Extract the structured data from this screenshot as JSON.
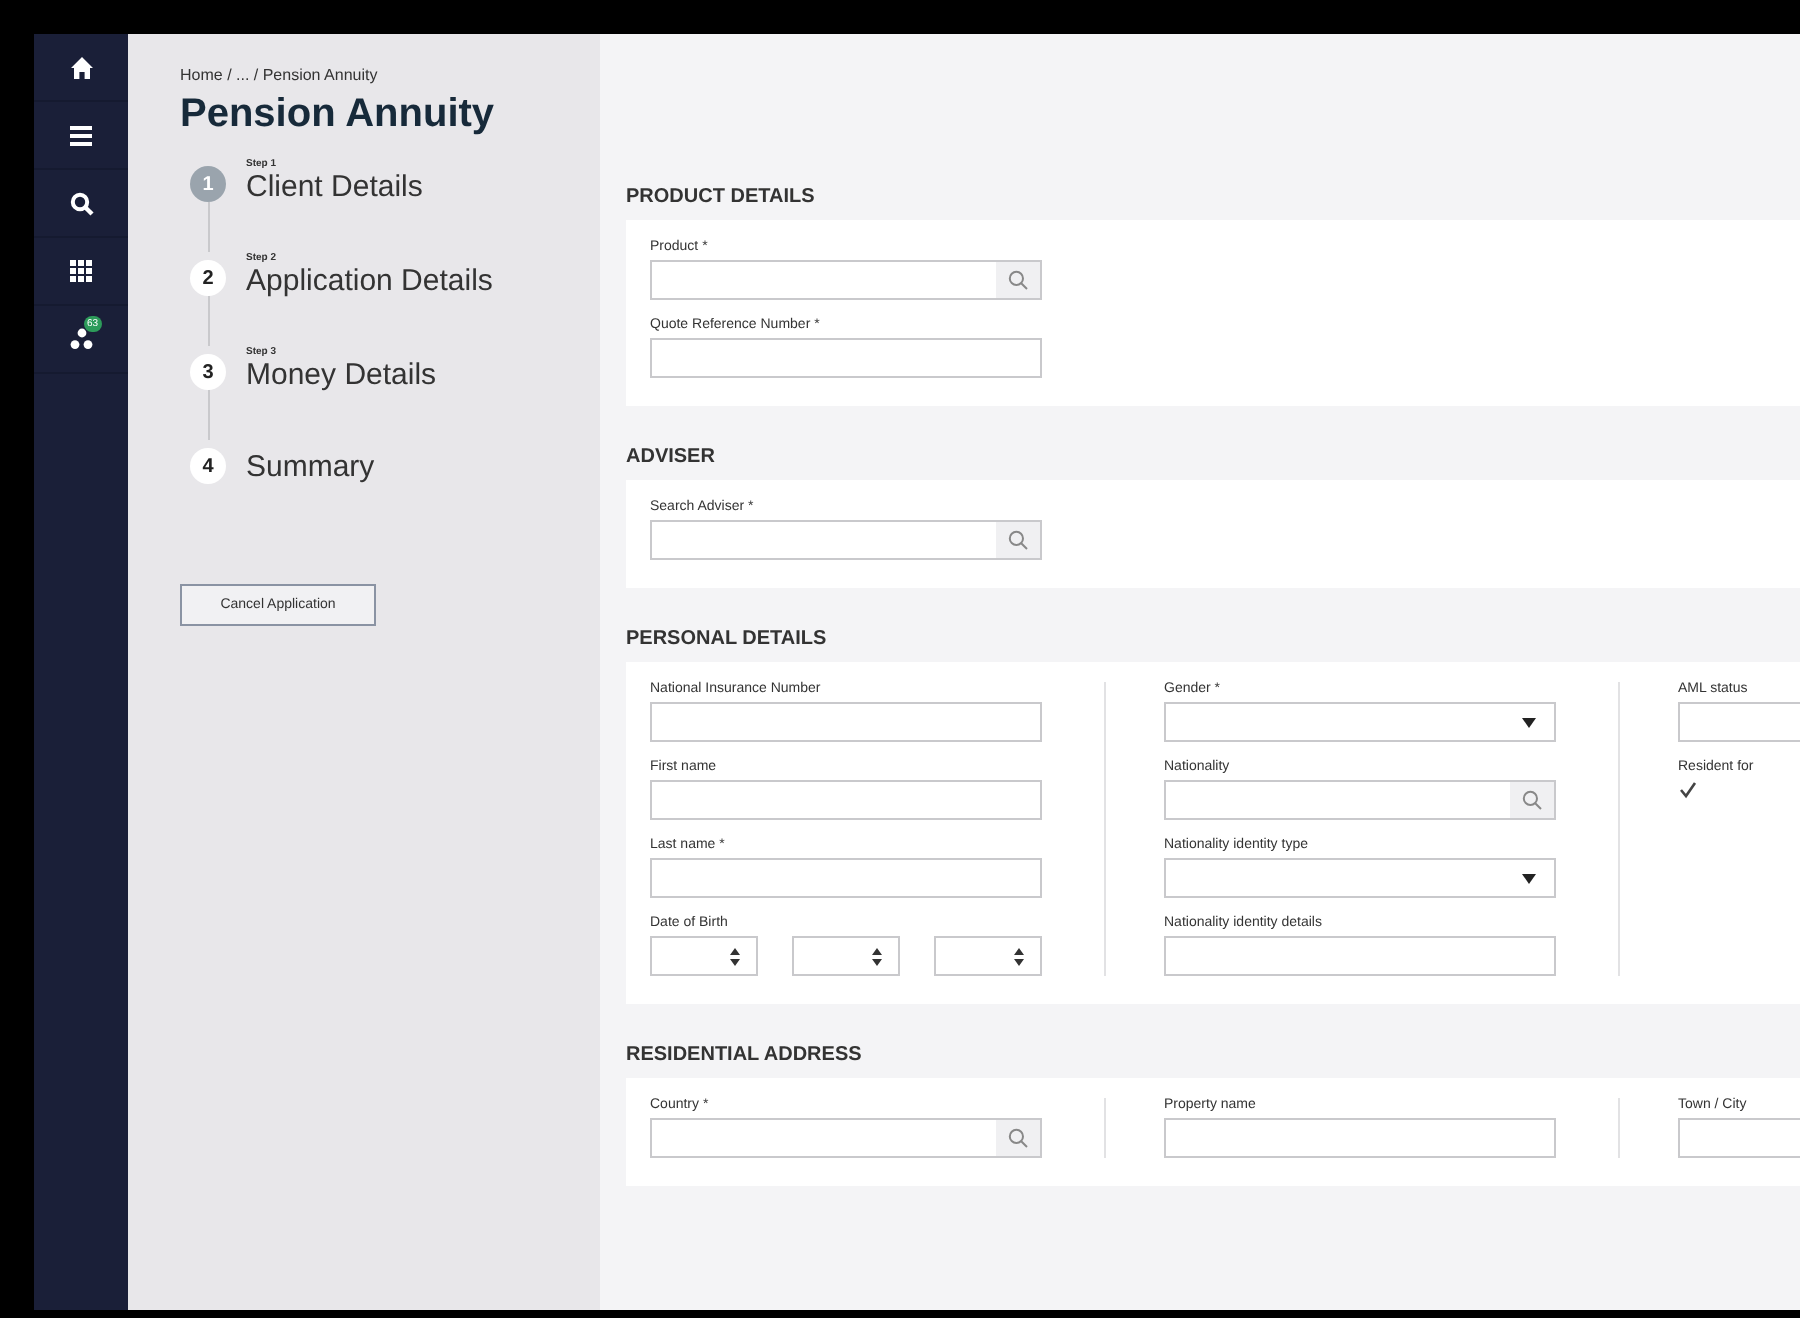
{
  "nav": [
    {
      "kind": "home"
    },
    {
      "kind": "menu"
    },
    {
      "kind": "search"
    },
    {
      "kind": "apps"
    },
    {
      "kind": "network",
      "badge": "63"
    }
  ],
  "breadcrumb": "Home / ... / Pension Annuity",
  "title": "Pension Annuity",
  "steps": [
    {
      "number": "1",
      "step_label": "Step 1",
      "title": "Client Details",
      "current": true
    },
    {
      "number": "2",
      "step_label": "Step 2",
      "title": "Application Details",
      "current": false
    },
    {
      "number": "3",
      "step_label": "Step 3",
      "title": "Money Details",
      "current": false
    },
    {
      "number": "4",
      "title": "Summary",
      "current": false
    }
  ],
  "cancel_button": "Cancel Application",
  "sections": [
    {
      "title": "PRODUCT DETAILS",
      "columns": [
        [
          {
            "label": "Product *",
            "kind": "search"
          },
          {
            "label": "Quote Reference Number *",
            "kind": "text"
          }
        ]
      ]
    },
    {
      "title": "ADVISER",
      "columns": [
        [
          {
            "label": "Search Adviser *",
            "kind": "search"
          }
        ]
      ]
    },
    {
      "title": "PERSONAL DETAILS",
      "columns": [
        [
          {
            "label": "National Insurance Number",
            "kind": "text"
          },
          {
            "label": "First name",
            "kind": "text"
          },
          {
            "label": "Last name *",
            "kind": "text"
          },
          {
            "label": "Date of Birth",
            "kind": "date"
          }
        ],
        [
          {
            "label": "Gender *",
            "kind": "select"
          },
          {
            "label": "Nationality",
            "kind": "search"
          },
          {
            "label": "Nationality identity type",
            "kind": "select"
          },
          {
            "label": "Nationality identity details",
            "kind": "text"
          }
        ],
        [
          {
            "label": "AML status",
            "kind": "text"
          },
          {
            "label": "Resident for",
            "kind": "checkbox",
            "checked": true
          }
        ]
      ]
    },
    {
      "title": "RESIDENTIAL ADDRESS",
      "columns": [
        [
          {
            "label": "Country *",
            "kind": "search"
          }
        ],
        [
          {
            "label": "Property name",
            "kind": "text"
          }
        ],
        [
          {
            "label": "Town / City",
            "kind": "text"
          }
        ]
      ]
    }
  ]
}
